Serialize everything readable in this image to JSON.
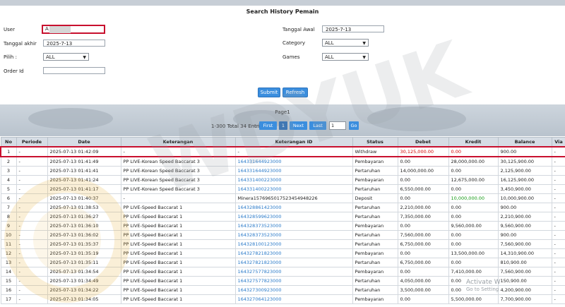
{
  "form": {
    "title": "Search History Pemain",
    "user_label": "User",
    "user_value": "A",
    "tanggal_akhir_label": "Tanggal akhir",
    "tanggal_akhir_value": "2025-7-13",
    "pilih_label": "Pilih :",
    "pilih_value": "ALL",
    "order_id_label": "Order Id",
    "order_id_value": "",
    "tanggal_awal_label": "Tanggal Awal",
    "tanggal_awal_value": "2025-7-13",
    "category_label": "Category",
    "category_value": "ALL",
    "games_label": "Games",
    "games_value": "ALL",
    "submit_label": "Submit",
    "refresh_label": "Refresh"
  },
  "pager": {
    "page_label": "Page1",
    "total_info": "1-300 Total 34 Entri",
    "first_label": "First",
    "current_page": "1",
    "next_label": "Next",
    "last_label": "Last",
    "page_input_value": "1",
    "go_label": "Go"
  },
  "table": {
    "headers": [
      "No",
      "Periode",
      "Date",
      "Keterangan",
      "Keterangan ID",
      "Status",
      "Debet",
      "Kredit",
      "Balance",
      "Via"
    ],
    "rows": [
      [
        "1",
        "-",
        "2025-07-13 01:42:09",
        "-",
        "-",
        "Withdraw",
        "30,125,000.00",
        "0.00",
        "900.00",
        "-"
      ],
      [
        "2",
        "-",
        "2025-07-13 01:41:49",
        "PP LIVE-Korean Speed Baccarat 3",
        "164331644923000",
        "Pembayaran",
        "0.00",
        "28,000,000.00",
        "30,125,900.00",
        "-"
      ],
      [
        "3",
        "-",
        "2025-07-13 01:41:41",
        "PP LIVE-Korean Speed Baccarat 3",
        "164331644923000",
        "Pertaruhan",
        "14,000,000.00",
        "0.00",
        "2,125,900.00",
        "-"
      ],
      [
        "4",
        "-",
        "2025-07-13 01:41:24",
        "PP LIVE-Korean Speed Baccarat 3",
        "164331400223000",
        "Pembayaran",
        "0.00",
        "12,675,000.00",
        "16,125,900.00",
        "-"
      ],
      [
        "5",
        "-",
        "2025-07-13 01:41:17",
        "PP LIVE-Korean Speed Baccarat 3",
        "164331400223000",
        "Pertaruhan",
        "6,550,000.00",
        "0.00",
        "3,450,900.00",
        "-"
      ],
      [
        "6",
        "-",
        "2025-07-13 01:40:37",
        "-",
        "Minera1576965017523454948226",
        "Deposit",
        "0.00",
        "10,000,000.00",
        "10,000,900.00",
        "-"
      ],
      [
        "7",
        "-",
        "2025-07-13 01:38:53",
        "PP LIVE-Speed Baccarat 1",
        "164328861423000",
        "Pertaruhan",
        "2,210,000.00",
        "0.00",
        "900.00",
        "-"
      ],
      [
        "8",
        "-",
        "2025-07-13 01:36:27",
        "PP LIVE-Speed Baccarat 1",
        "164328599623000",
        "Pertaruhan",
        "7,350,000.00",
        "0.00",
        "2,210,900.00",
        "-"
      ],
      [
        "9",
        "-",
        "2025-07-13 01:36:10",
        "PP LIVE-Speed Baccarat 1",
        "164328373523000",
        "Pembayaran",
        "0.00",
        "9,560,000.00",
        "9,560,900.00",
        "-"
      ],
      [
        "10",
        "-",
        "2025-07-13 01:36:02",
        "PP LIVE-Speed Baccarat 1",
        "164328373523000",
        "Pertaruhan",
        "7,560,000.00",
        "0.00",
        "900.00",
        "-"
      ],
      [
        "11",
        "-",
        "2025-07-13 01:35:37",
        "PP LIVE-Speed Baccarat 1",
        "164328100123000",
        "Pertaruhan",
        "6,750,000.00",
        "0.00",
        "7,560,900.00",
        "-"
      ],
      [
        "12",
        "-",
        "2025-07-13 01:35:19",
        "PP LIVE-Speed Baccarat 1",
        "164327821823000",
        "Pembayaran",
        "0.00",
        "13,500,000.00",
        "14,310,900.00",
        "-"
      ],
      [
        "13",
        "-",
        "2025-07-13 01:35:11",
        "PP LIVE-Speed Baccarat 1",
        "164327821823000",
        "Pertaruhan",
        "6,750,000.00",
        "0.00",
        "810,900.00",
        "-"
      ],
      [
        "14",
        "-",
        "2025-07-13 01:34:54",
        "PP LIVE-Speed Baccarat 1",
        "164327577823000",
        "Pembayaran",
        "0.00",
        "7,410,000.00",
        "7,560,900.00",
        "-"
      ],
      [
        "15",
        "-",
        "2025-07-13 01:34:49",
        "PP LIVE-Speed Baccarat 1",
        "164327577823000",
        "Pertaruhan",
        "4,050,000.00",
        "0.00",
        "150,900.00",
        "-"
      ],
      [
        "16",
        "-",
        "2025-07-13 01:34:22",
        "PP LIVE-Speed Baccarat 1",
        "164327300923000",
        "Pertaruhan",
        "3,500,000.00",
        "0.00",
        "4,200,900.00",
        "-"
      ],
      [
        "17",
        "-",
        "2025-07-13 01:34:05",
        "PP LIVE-Speed Baccarat 1",
        "164327064123000",
        "Pembayaran",
        "0.00",
        "5,500,000.00",
        "7,700,900.00",
        "-"
      ]
    ]
  },
  "overlay": {
    "activate_line1": "Activate W",
    "activate_line2": "Go to Setting"
  },
  "colors": {
    "accent_blue": "#3b8ede",
    "highlight_red": "#c8102e",
    "debit_red": "#d40000",
    "credit_green": "#119911",
    "link_blue": "#2a7ac9"
  }
}
